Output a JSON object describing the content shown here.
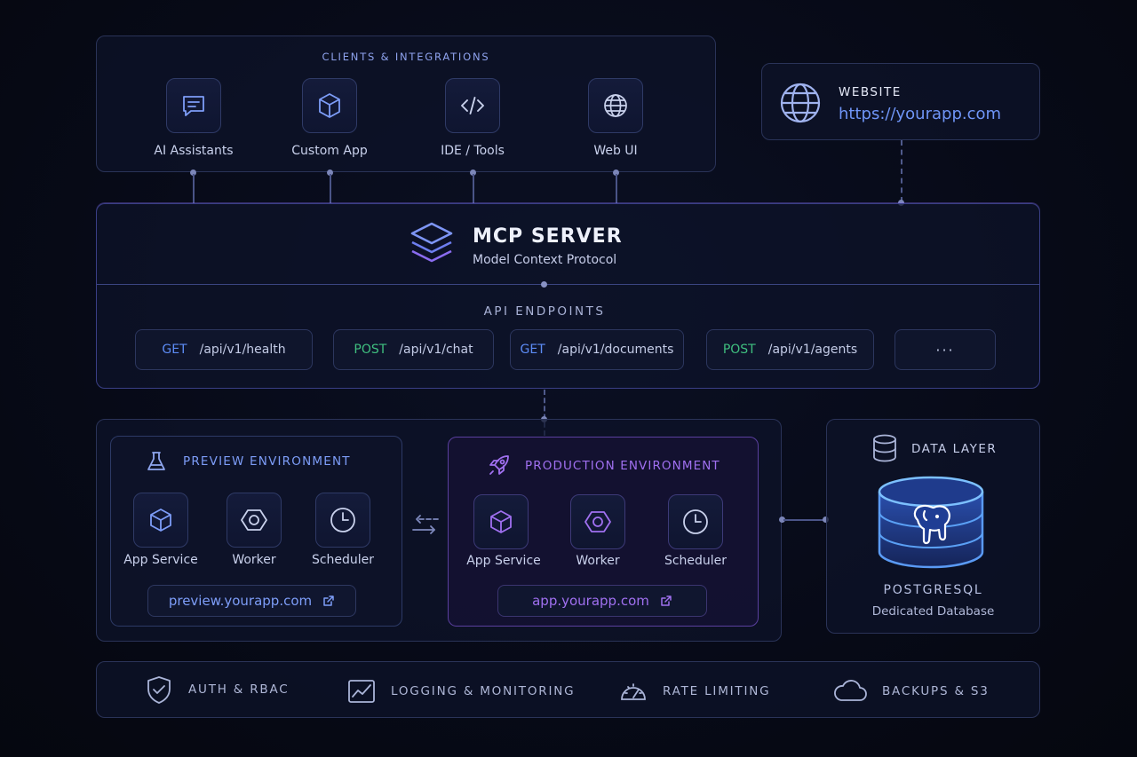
{
  "clients": {
    "title": "CLIENTS & INTEGRATIONS",
    "items": [
      {
        "label": "AI Assistants",
        "icon": "chat-icon"
      },
      {
        "label": "Custom App",
        "icon": "cube-icon"
      },
      {
        "label": "IDE / Tools",
        "icon": "code-icon"
      },
      {
        "label": "Web UI",
        "icon": "globe-icon"
      }
    ]
  },
  "website": {
    "title": "WEBSITE",
    "url": "https://yourapp.com"
  },
  "server": {
    "title": "MCP SERVER",
    "subtitle": "Model Context Protocol",
    "endpoints_title": "API ENDPOINTS",
    "endpoints": [
      {
        "method": "GET",
        "path": "/api/v1/health"
      },
      {
        "method": "POST",
        "path": "/api/v1/chat"
      },
      {
        "method": "GET",
        "path": "/api/v1/documents"
      },
      {
        "method": "POST",
        "path": "/api/v1/agents"
      },
      {
        "method": "",
        "path": "···"
      }
    ]
  },
  "preview": {
    "title": "PREVIEW ENVIRONMENT",
    "services": [
      "App Service",
      "Worker",
      "Scheduler"
    ],
    "url": "preview.yourapp.com"
  },
  "production": {
    "title": "PRODUCTION ENVIRONMENT",
    "services": [
      "App Service",
      "Worker",
      "Scheduler"
    ],
    "url": "app.yourapp.com"
  },
  "data": {
    "title": "DATA LAYER",
    "db_name": "POSTGRESQL",
    "db_desc": "Dedicated Database"
  },
  "footer": {
    "items": [
      {
        "label": "AUTH & RBAC",
        "icon": "shield-icon"
      },
      {
        "label": "LOGGING & MONITORING",
        "icon": "chart-icon"
      },
      {
        "label": "RATE LIMITING",
        "icon": "gauge-icon"
      },
      {
        "label": "BACKUPS & S3",
        "icon": "cloud-icon"
      }
    ]
  },
  "colors": {
    "accent_blue": "#6f95f7",
    "accent_purple": "#a070f0",
    "get": "#5c8bf5",
    "post": "#3fbf7f"
  }
}
